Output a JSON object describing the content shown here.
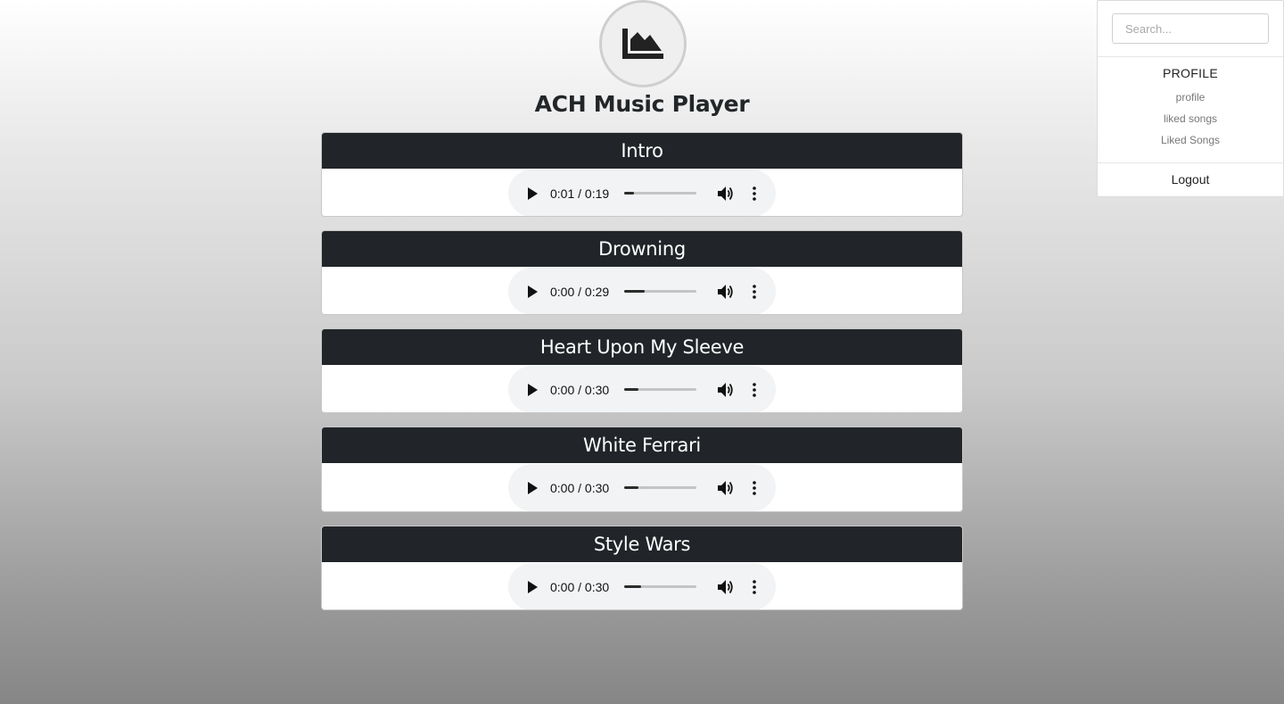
{
  "app": {
    "title": "ACH Music Player",
    "logo_icon": "area-chart-icon"
  },
  "songs": [
    {
      "title": "Intro",
      "time": "0:01 / 0:19",
      "progress": 0.14
    },
    {
      "title": "Drowning",
      "time": "0:00 / 0:29",
      "progress": 0.29
    },
    {
      "title": "Heart Upon My Sleeve",
      "time": "0:00 / 0:30",
      "progress": 0.2
    },
    {
      "title": "White Ferrari",
      "time": "0:00 / 0:30",
      "progress": 0.2
    },
    {
      "title": "Style Wars",
      "time": "0:00 / 0:30",
      "progress": 0.24
    }
  ],
  "sidebar": {
    "search_placeholder": "Search...",
    "heading": "PROFILE",
    "links": [
      "profile",
      "liked songs",
      "Liked Songs"
    ],
    "logout": "Logout"
  },
  "colors": {
    "header_bg": "#212529",
    "player_bg": "#f1f3f4"
  }
}
